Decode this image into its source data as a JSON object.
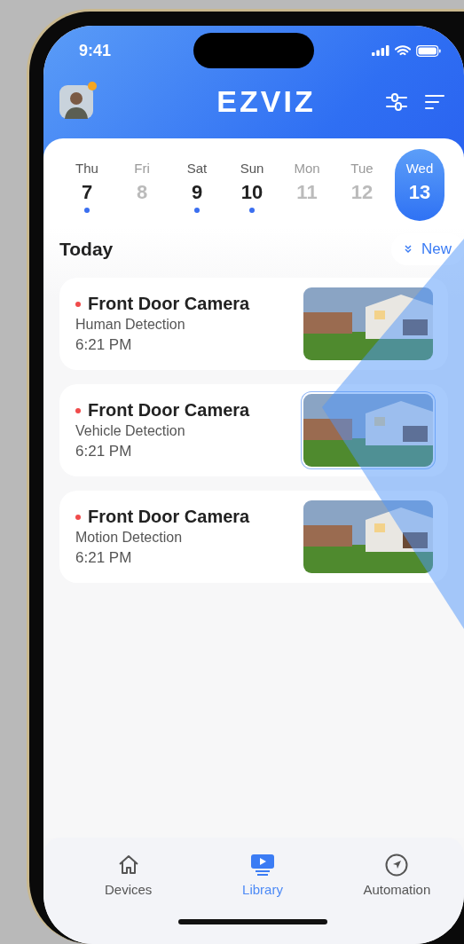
{
  "status_bar": {
    "time": "9:41"
  },
  "header": {
    "logo": "EZVIZ",
    "avatar_notification": true
  },
  "days": [
    {
      "day": "Thu",
      "date": "7",
      "has_events": true,
      "selected": false
    },
    {
      "day": "Fri",
      "date": "8",
      "has_events": false,
      "selected": false
    },
    {
      "day": "Sat",
      "date": "9",
      "has_events": true,
      "selected": false
    },
    {
      "day": "Sun",
      "date": "10",
      "has_events": true,
      "selected": false
    },
    {
      "day": "Mon",
      "date": "11",
      "has_events": false,
      "selected": false
    },
    {
      "day": "Tue",
      "date": "12",
      "has_events": false,
      "selected": false
    },
    {
      "day": "Wed",
      "date": "13",
      "has_events": false,
      "selected": true
    }
  ],
  "section": {
    "title": "Today",
    "new_button": "New"
  },
  "events": [
    {
      "camera": "Front Door Camera",
      "type": "Human Detection",
      "time": "6:21 PM",
      "unread": true,
      "selected": false
    },
    {
      "camera": "Front Door Camera",
      "type": "Vehicle Detection",
      "time": "6:21 PM",
      "unread": true,
      "selected": true
    },
    {
      "camera": "Front Door Camera",
      "type": "Motion Detection",
      "time": "6:21 PM",
      "unread": true,
      "selected": false
    }
  ],
  "tabs": [
    {
      "label": "Devices",
      "selected": false
    },
    {
      "label": "Library",
      "selected": true
    },
    {
      "label": "Automation",
      "selected": false
    }
  ]
}
